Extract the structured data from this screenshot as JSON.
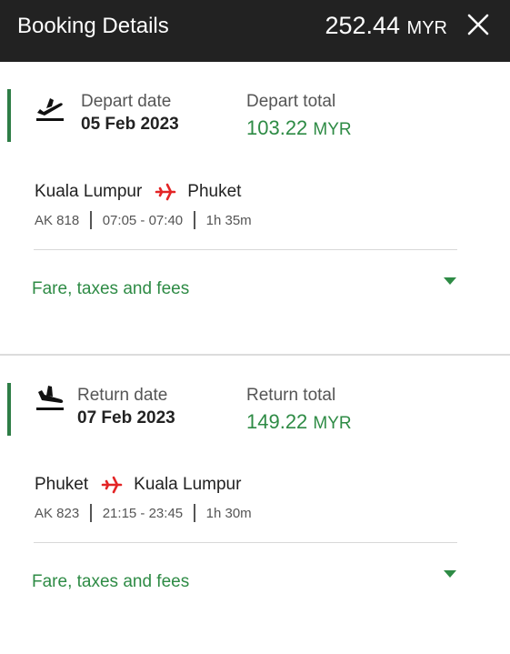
{
  "header": {
    "title": "Booking Details",
    "total_amount": "252.44",
    "total_currency": "MYR"
  },
  "depart": {
    "date_label": "Depart date",
    "date_value": "05 Feb 2023",
    "total_label": "Depart total",
    "total_amount": "103.22",
    "total_currency": "MYR",
    "origin": "Kuala Lumpur",
    "destination": "Phuket",
    "flight_number": "AK 818",
    "time": "07:05 - 07:40",
    "duration": "1h 35m",
    "fare_label": "Fare, taxes and fees"
  },
  "return": {
    "date_label": "Return date",
    "date_value": "07 Feb 2023",
    "total_label": "Return total",
    "total_amount": "149.22",
    "total_currency": "MYR",
    "origin": "Phuket",
    "destination": "Kuala Lumpur",
    "flight_number": "AK 823",
    "time": "21:15 - 23:45",
    "duration": "1h 30m",
    "fare_label": "Fare, taxes and fees"
  },
  "icons": {
    "close": "close-icon",
    "depart": "plane-takeoff-icon",
    "arrive": "plane-landing-icon",
    "route": "airplane-icon",
    "expand": "caret-down-icon"
  },
  "colors": {
    "header_bg": "#222222",
    "accent_green": "#2e8b45",
    "bar_green": "#2e7d46",
    "plane_red": "#e32526"
  }
}
